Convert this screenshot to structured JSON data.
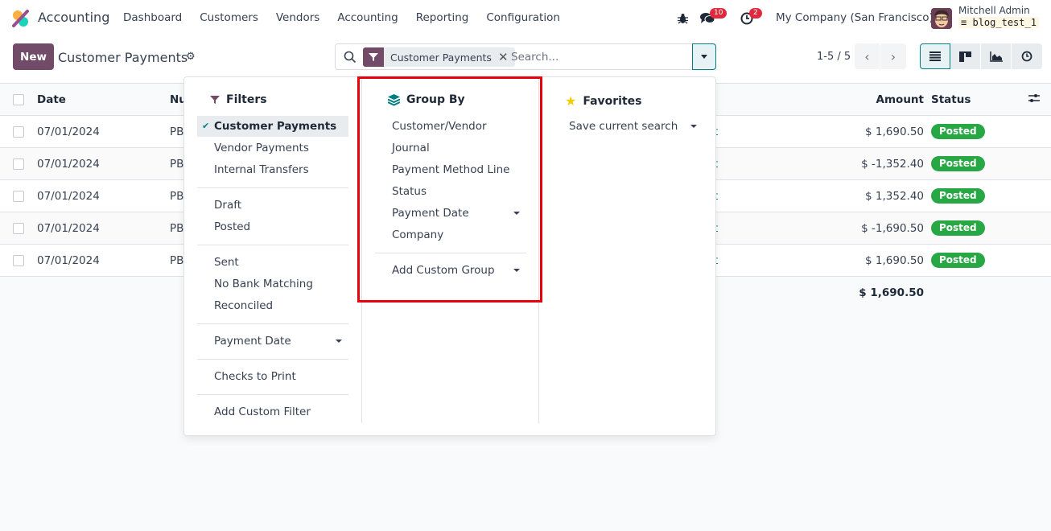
{
  "navbar": {
    "app_name": "Accounting",
    "menu": [
      "Dashboard",
      "Customers",
      "Vendors",
      "Accounting",
      "Reporting",
      "Configuration"
    ],
    "messages_count": "10",
    "activities_count": "2",
    "company": "My Company (San Francisco)",
    "user_name": "Mitchell Admin",
    "database": "blog_test_1"
  },
  "control_panel": {
    "new_label": "New",
    "title": "Customer Payments",
    "search": {
      "facet_label": "Customer Payments",
      "placeholder": "Search..."
    },
    "pager": "1-5 / 5",
    "views": [
      "list-view",
      "kanban-view",
      "graph-view",
      "activity-view"
    ],
    "active_view": "list-view"
  },
  "list": {
    "headers": {
      "date": "Date",
      "number": "Nu",
      "amount": "Amount",
      "status": "Status"
    },
    "rows": [
      {
        "date": "07/01/2024",
        "number": "PB",
        "partner": "t",
        "amount": "$ 1,690.50",
        "status": "Posted"
      },
      {
        "date": "07/01/2024",
        "number": "PB",
        "partner": "t",
        "amount": "$ -1,352.40",
        "status": "Posted"
      },
      {
        "date": "07/01/2024",
        "number": "PB",
        "partner": "t",
        "amount": "$ 1,352.40",
        "status": "Posted"
      },
      {
        "date": "07/01/2024",
        "number": "PB",
        "partner": "t",
        "amount": "$ -1,690.50",
        "status": "Posted"
      },
      {
        "date": "07/01/2024",
        "number": "PB",
        "partner": "t",
        "amount": "$ 1,690.50",
        "status": "Posted"
      }
    ],
    "total": "$ 1,690.50"
  },
  "dropdown": {
    "filters": {
      "title": "Filters",
      "items": [
        {
          "label": "Customer Payments",
          "selected": true
        },
        {
          "label": "Vendor Payments"
        },
        {
          "label": "Internal Transfers"
        },
        {
          "label": "Draft"
        },
        {
          "label": "Posted"
        },
        {
          "label": "Sent"
        },
        {
          "label": "No Bank Matching"
        },
        {
          "label": "Reconciled"
        },
        {
          "label": "Payment Date",
          "has_submenu": true
        },
        {
          "label": "Checks to Print"
        },
        {
          "label": "Add Custom Filter"
        }
      ]
    },
    "group_by": {
      "title": "Group By",
      "items": [
        {
          "label": "Customer/Vendor"
        },
        {
          "label": "Journal"
        },
        {
          "label": "Payment Method Line"
        },
        {
          "label": "Status"
        },
        {
          "label": "Payment Date",
          "has_submenu": true
        },
        {
          "label": "Company"
        },
        {
          "label": "Add Custom Group",
          "has_submenu": true
        }
      ]
    },
    "favorites": {
      "title": "Favorites",
      "items": [
        {
          "label": "Save current search",
          "has_submenu": true
        }
      ]
    }
  },
  "colors": {
    "brand": "#714b67",
    "accent": "#017e84",
    "posted": "#28a745",
    "badge": "#e0293d",
    "highlight": "#e8000b"
  }
}
